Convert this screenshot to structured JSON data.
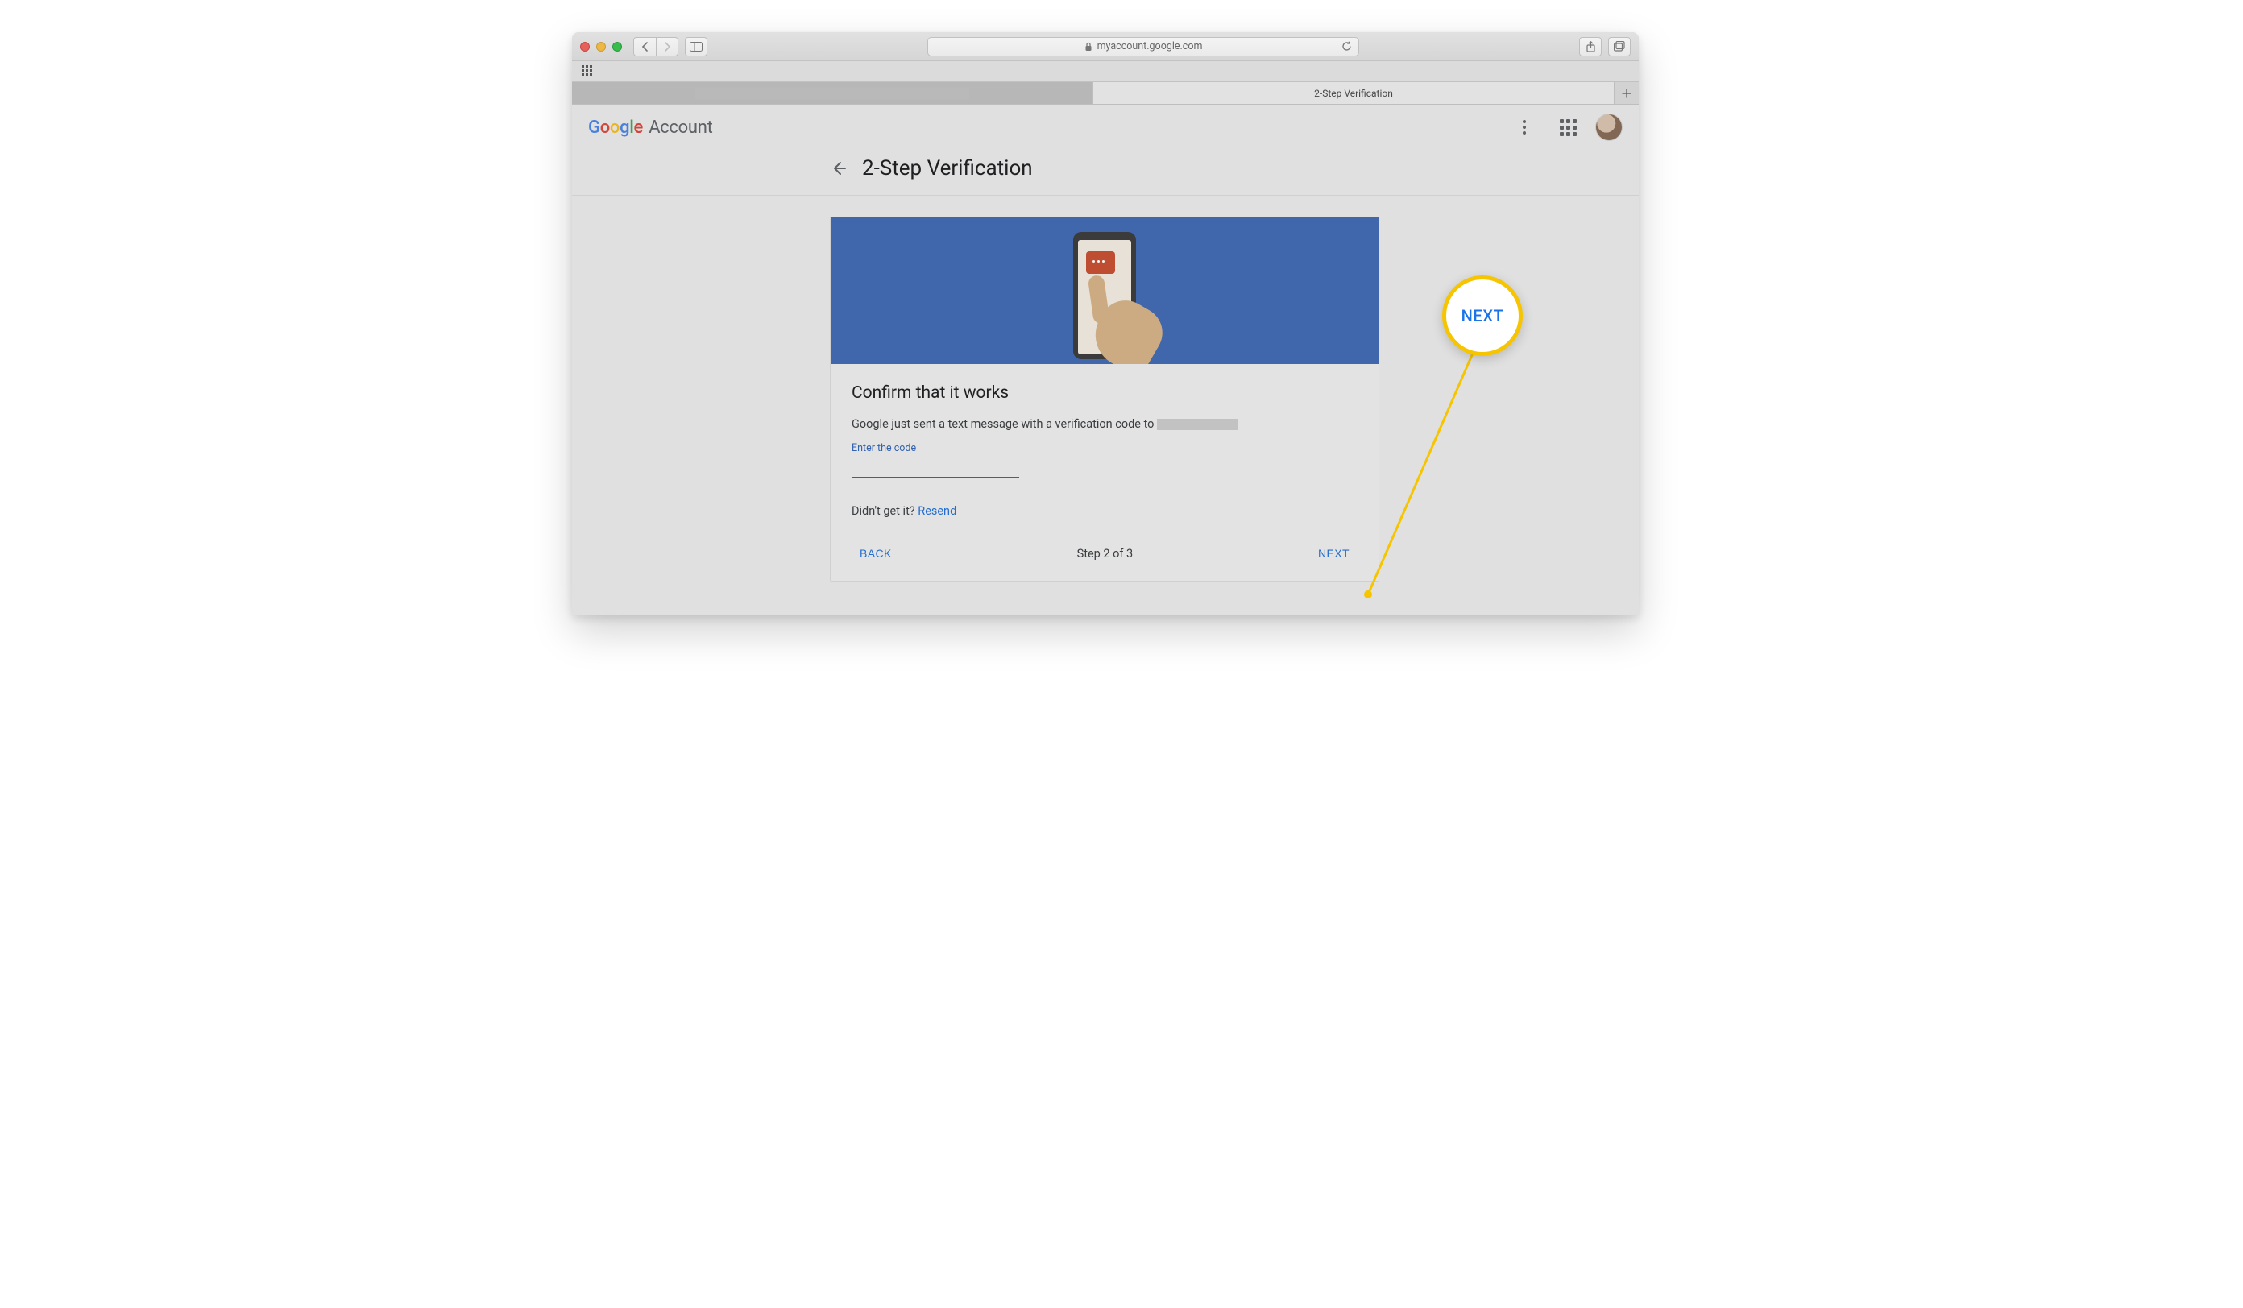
{
  "browser": {
    "url_display": "myaccount.google.com",
    "tabs": {
      "active_label": "2-Step Verification"
    }
  },
  "header": {
    "logo_text": "Google",
    "logo_suffix": "Account"
  },
  "subheader": {
    "title": "2-Step Verification"
  },
  "card": {
    "heading": "Confirm that it works",
    "description_prefix": "Google just sent a text message with a verification code to",
    "input_label": "Enter the code",
    "resend_prefix": "Didn't get it? ",
    "resend_link": "Resend"
  },
  "footer": {
    "back": "BACK",
    "step": "Step 2 of 3",
    "next": "NEXT"
  },
  "callout": {
    "label": "NEXT"
  }
}
